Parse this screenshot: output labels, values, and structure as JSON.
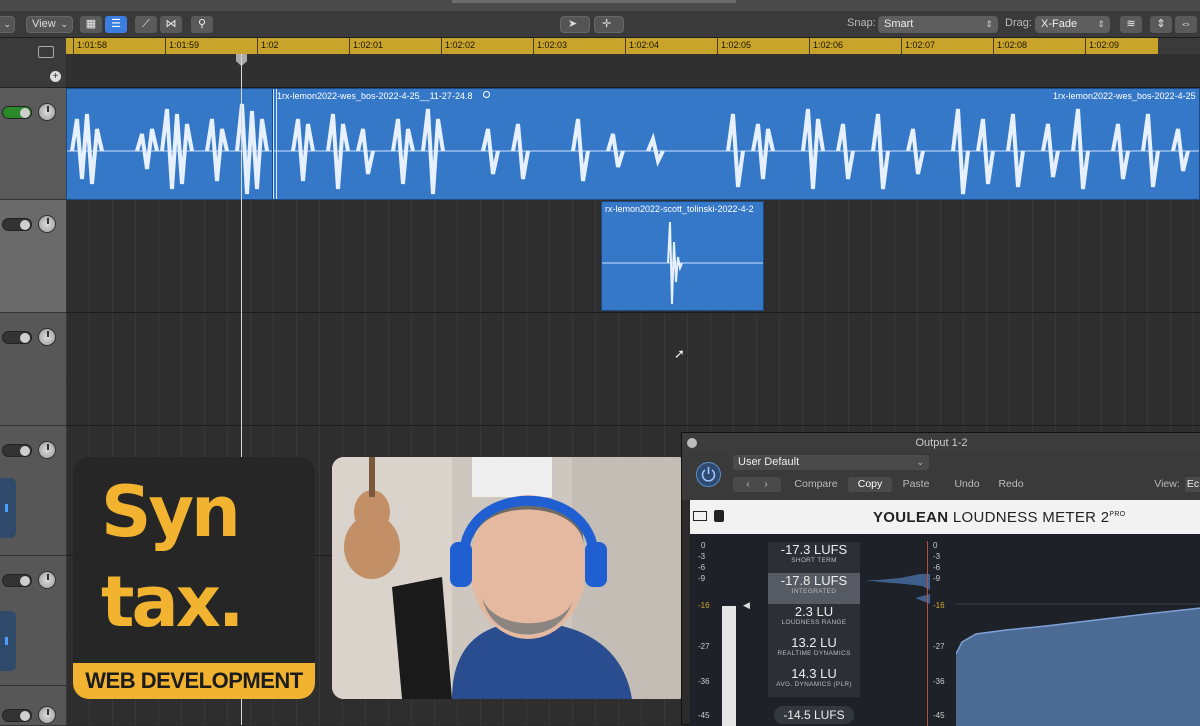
{
  "toolbar": {
    "menu_partial": "s",
    "view_label": "View",
    "snap_label": "Snap:",
    "snap_value": "Smart",
    "drag_label": "Drag:",
    "drag_value": "X-Fade"
  },
  "ruler": {
    "ticks": [
      "1:01:58",
      "1:01:59",
      "1:02",
      "1:02:01",
      "1:02:02",
      "1:02:03",
      "1:02:04",
      "1:02:05",
      "1:02:06",
      "1:02:07",
      "1:02:08",
      "1:02:09"
    ]
  },
  "regions": {
    "region1_name": "1rx-lemon2022-wes_bos-2022-4-25__11-27-24.8",
    "region1_name_right": "1rx-lemon2022-wes_bos-2022-4-25",
    "region2_name": "rx-lemon2022-scott_tolinski-2022-4-2"
  },
  "overlay": {
    "syntax_line1": "Syn",
    "syntax_line2": "tax.",
    "syntax_band": "WEB DEVELOPMENT"
  },
  "plugin": {
    "title": "Output 1-2",
    "preset": "User Default",
    "compare": "Compare",
    "copy": "Copy",
    "paste": "Paste",
    "undo": "Undo",
    "redo": "Redo",
    "view_label": "View:",
    "view_value": "Ec",
    "brand_bold": "YOULEAN",
    "brand_rest": " LOUDNESS METER 2",
    "brand_sup": "PRO",
    "metrics": [
      {
        "value": "-17.3 LUFS",
        "name": "SHORT TERM"
      },
      {
        "value": "-17.8 LUFS",
        "name": "INTEGRATED"
      },
      {
        "value": "2.3 LU",
        "name": "LOUDNESS RANGE"
      },
      {
        "value": "13.2 LU",
        "name": "REALTIME DYNAMICS"
      },
      {
        "value": "14.3 LU",
        "name": "AVG. DYNAMICS (PLR)"
      }
    ],
    "bottom_value": "-14.5 LUFS",
    "scale_left": [
      "0",
      "-3",
      "-6",
      "-9",
      "-16",
      "-27",
      "-36",
      "-45"
    ],
    "scale_right": [
      "0",
      "-3",
      "-6",
      "-9",
      "-16",
      "-27",
      "-36",
      "-45"
    ]
  }
}
